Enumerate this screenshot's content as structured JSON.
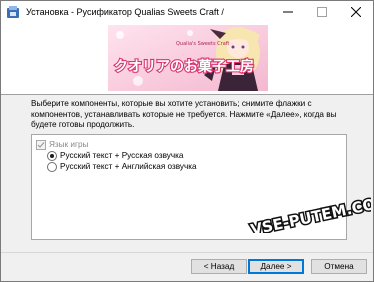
{
  "window": {
    "title": "Установка - Русификатор Qualias Sweets Craft /"
  },
  "banner": {
    "logo_text": "クオリアのお菓子工房",
    "logo_subtext": "Qualia's Sweets Craft"
  },
  "instructions": "Выберите компоненты, которые вы хотите установить; снимите флажки с компонентов, устанавливать которые не требуется. Нажмите «Далее», когда вы будете готовы продолжить.",
  "components": {
    "group_label": "Язык игры",
    "group_checked": true,
    "options": [
      {
        "label": "Русский текст + Русская озвучка",
        "selected": true
      },
      {
        "label": "Русский текст + Английская озвучка",
        "selected": false
      }
    ]
  },
  "buttons": {
    "back": "< Назад",
    "next": "Далее >",
    "cancel": "Отмена"
  },
  "watermark": "VSE-PUTEM.COM",
  "colors": {
    "accent": "#0078d7",
    "banner_pink": "#f3b8cf"
  },
  "icons": [
    "installer-app-icon",
    "minimize-icon",
    "maximize-icon",
    "close-icon",
    "checkbox-check-icon"
  ]
}
